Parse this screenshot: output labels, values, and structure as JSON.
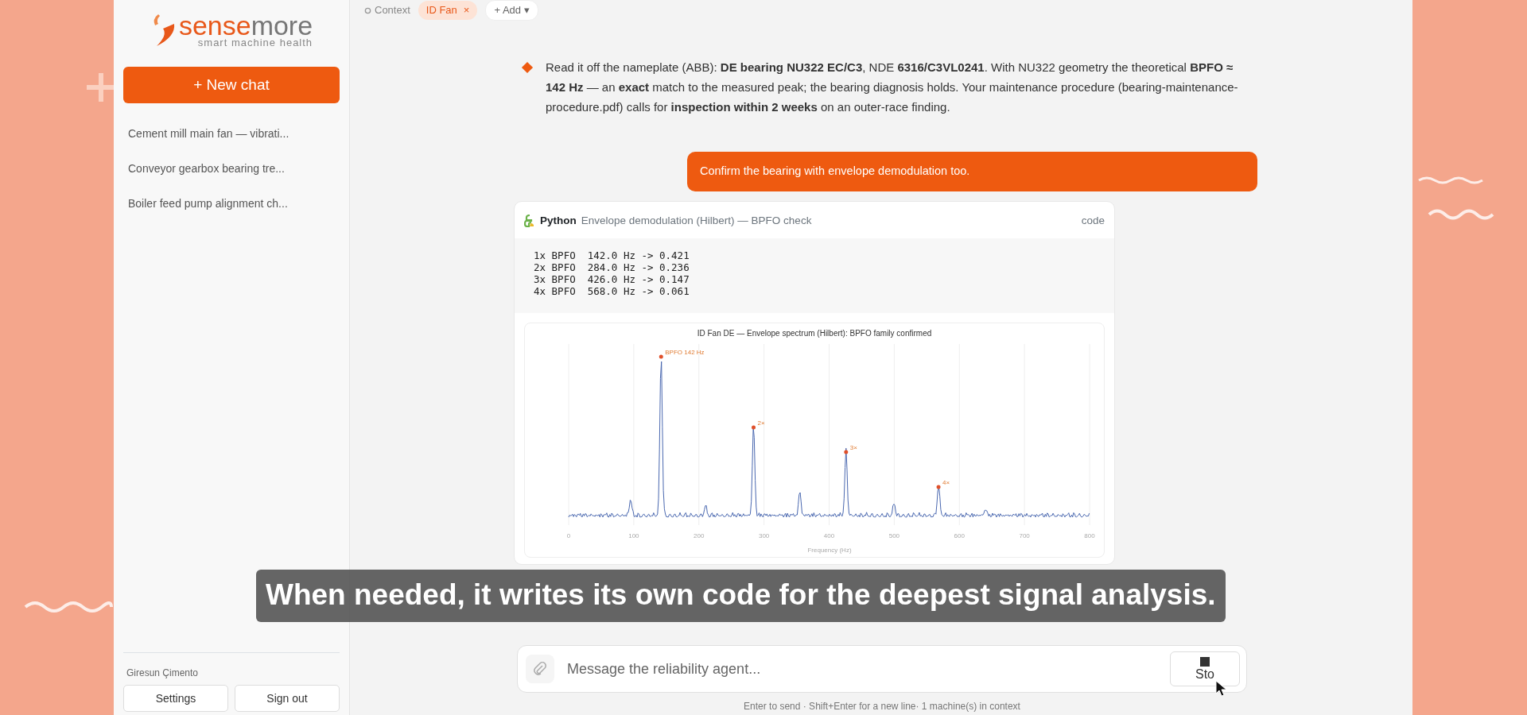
{
  "sidebar": {
    "logo": {
      "brand_a": "sense",
      "brand_b": "more",
      "tagline": "smart machine health"
    },
    "new_chat": {
      "icon": "+",
      "label": "New chat"
    },
    "chats": [
      {
        "title": "Cement mill main fan — vibrati..."
      },
      {
        "title": "Conveyor gearbox bearing tre..."
      },
      {
        "title": "Boiler feed pump alignment ch..."
      }
    ],
    "account": "Giresun Çimento",
    "buttons": [
      "Settings",
      "Sign out"
    ]
  },
  "context_bar": {
    "label": "Context",
    "chips": [
      {
        "label": "ID Fan",
        "close": "×"
      }
    ],
    "add": {
      "icon": "+",
      "label": "Add",
      "caret": "▾"
    }
  },
  "messages": [
    {
      "kind": "assistant",
      "text": "Read it off the nameplate (ABB): **DE bearing NU322 EC/C3**, NDE **6316/C3VL0241**. With NU322 geometry the theoretical **BPFO ≈ 142 Hz** — an **exact** match to the measured peak; the bearing diagnosis holds. Your maintenance procedure (bearing-maintenance-procedure.pdf) calls for **inspection within 2 weeks** on an outer-race finding."
    },
    {
      "kind": "user",
      "text": "Confirm the bearing with envelope demodulation too."
    },
    {
      "kind": "code",
      "language": "Python",
      "title": "Envelope demodulation (Hilbert) — BPFO check",
      "toggle": "code",
      "output": [
        "1x BPFO  142.0 Hz -> 0.421",
        "2x BPFO  284.0 Hz -> 0.236",
        "3x BPFO  426.0 Hz -> 0.147",
        "4x BPFO  568.0 Hz -> 0.061"
      ],
      "chart": {
        "title": "ID Fan DE — Envelope spectrum (Hilbert): BPFO family confirmed",
        "xticks": [
          "0",
          "100",
          "200",
          "300",
          "400",
          "500",
          "600",
          "700",
          "800"
        ],
        "xlabel": "Frequency (Hz)",
        "peak_labels": [
          "BPFO 142 Hz",
          "2×",
          "3×",
          "4×"
        ]
      }
    }
  ],
  "caption": "When needed, it writes its own code for the deepest signal analysis.",
  "composer": {
    "placeholder": "Message the reliability agent...",
    "stop": "Sto",
    "hint": "Enter to send · Shift+Enter for a new line· 1 machine(s) in context"
  }
}
